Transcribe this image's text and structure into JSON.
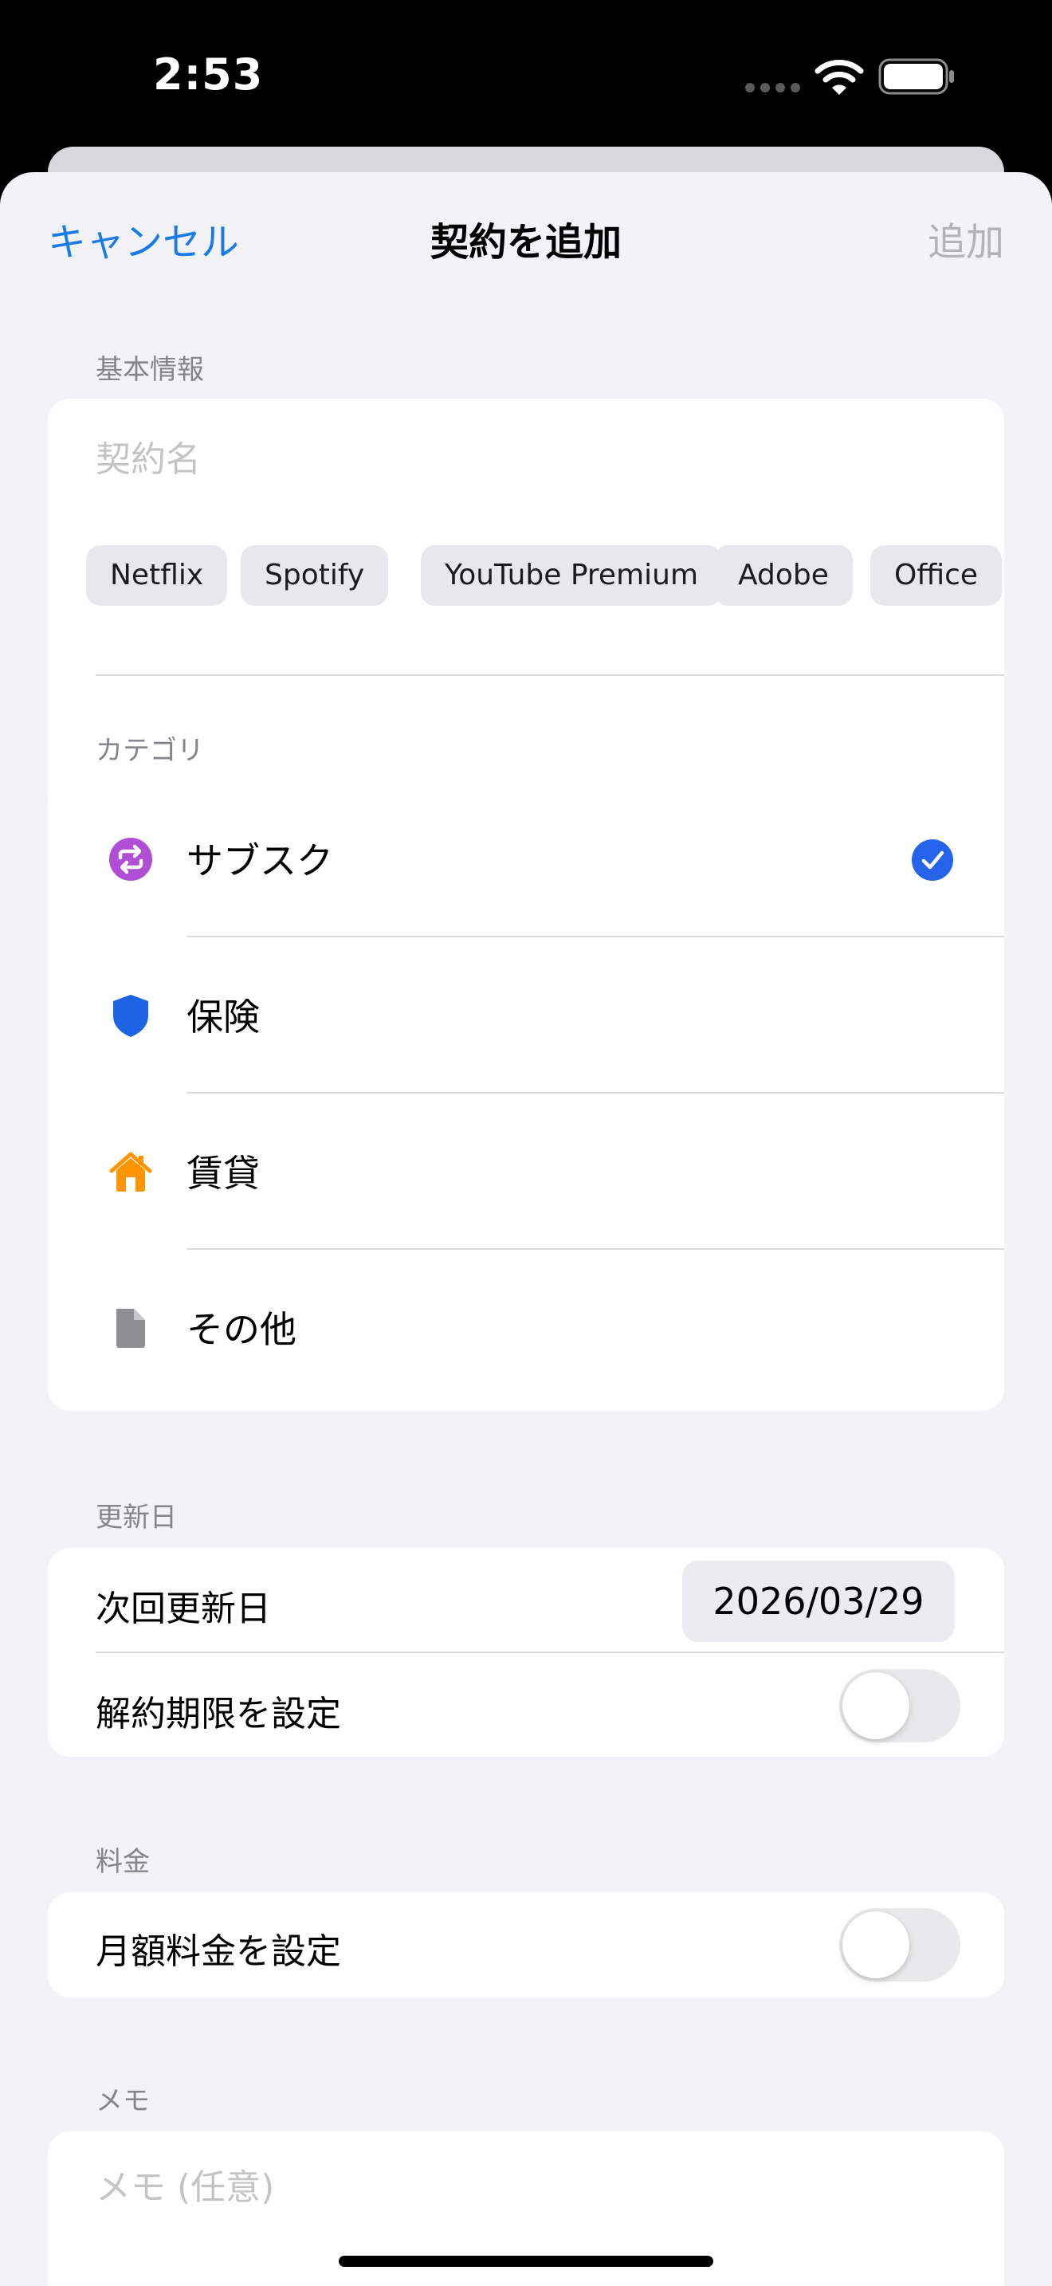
{
  "status_bar": {
    "time": "2:53"
  },
  "nav": {
    "cancel": "キャンセル",
    "title": "契約を追加",
    "add": "追加"
  },
  "basic_info": {
    "header": "基本情報",
    "name_placeholder": "契約名",
    "suggestions": [
      "Netflix",
      "Spotify",
      "YouTube Premium",
      "Adobe",
      "Office"
    ]
  },
  "category": {
    "header": "カテゴリ",
    "items": [
      {
        "label": "サブスク",
        "icon": "repeat-icon",
        "color": "#b04fd6",
        "selected": true
      },
      {
        "label": "保険",
        "icon": "shield-icon",
        "color": "#1d63e6",
        "selected": false
      },
      {
        "label": "賃貸",
        "icon": "house-icon",
        "color": "#ff9500",
        "selected": false
      },
      {
        "label": "その他",
        "icon": "document-icon",
        "color": "#8e8e93",
        "selected": false
      }
    ]
  },
  "renewal": {
    "header": "更新日",
    "next_label": "次回更新日",
    "next_value": "2026/03/29",
    "deadline_label": "解約期限を設定",
    "deadline_on": false
  },
  "price": {
    "header": "料金",
    "monthly_label": "月額料金を設定",
    "monthly_on": false
  },
  "memo": {
    "header": "メモ",
    "placeholder": "メモ (任意)"
  },
  "colors": {
    "accent": "#1a7ae6",
    "check": "#2563eb",
    "background": "#f2f2f7"
  }
}
